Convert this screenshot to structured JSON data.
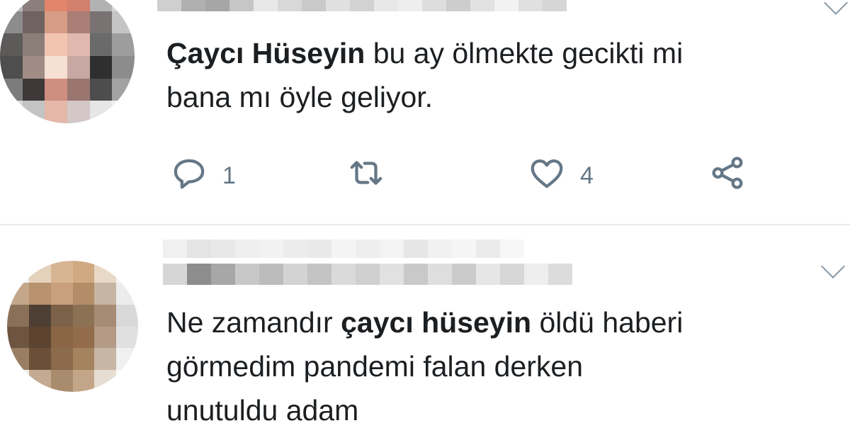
{
  "tweets": [
    {
      "text_bold": "Çaycı Hüseyin",
      "text_line1_rest": " bu ay ölmekte gecikti mi",
      "text_line2": "bana mı öyle geliyor.",
      "actions": {
        "reply_count": "1",
        "like_count": "4"
      }
    },
    {
      "text_prefix": "Ne zamandır ",
      "text_bold": "çaycı hüseyin",
      "text_line1_rest": " öldü haberi",
      "text_line2": "görmedim pandemi falan derken",
      "text_line3": "unutuldu adam"
    }
  ],
  "icons": {
    "reply": "reply-icon",
    "retweet": "retweet-icon",
    "like": "heart-icon",
    "share": "share-icon",
    "menu": "chevron-down-icon"
  },
  "colors": {
    "icon_gray": "#657786",
    "divider": "#e6ecf0"
  }
}
